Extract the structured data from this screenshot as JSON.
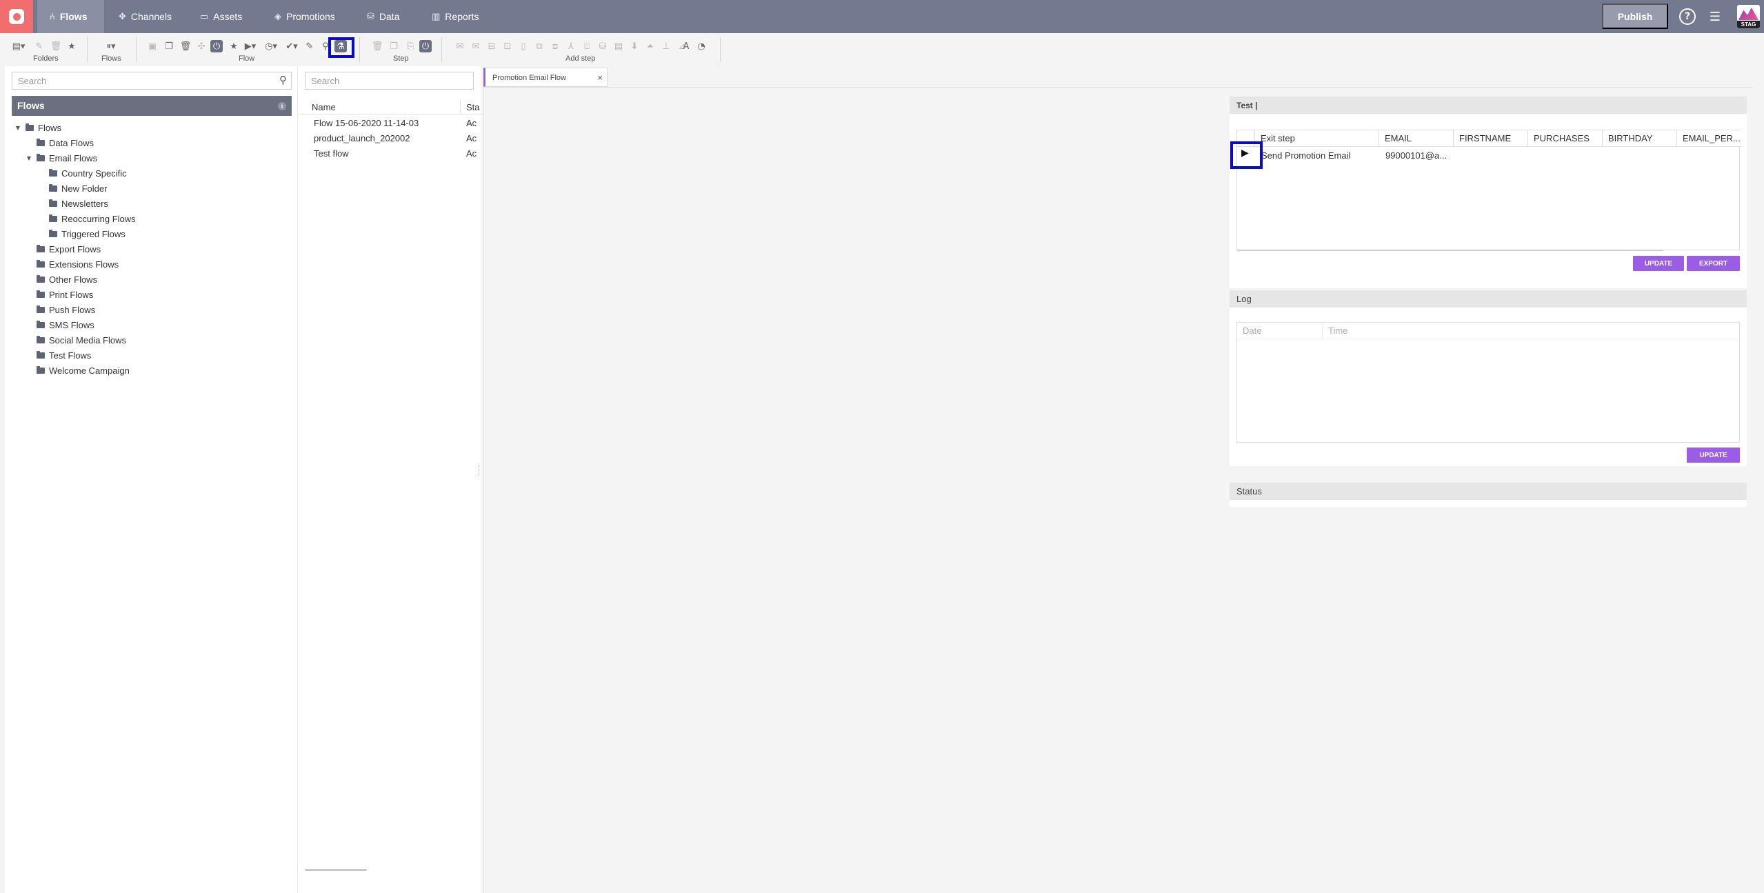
{
  "nav": {
    "items": [
      {
        "label": "Flows",
        "icon": "flows-icon"
      },
      {
        "label": "Channels",
        "icon": "channels-icon"
      },
      {
        "label": "Assets",
        "icon": "assets-icon"
      },
      {
        "label": "Promotions",
        "icon": "promotions-icon"
      },
      {
        "label": "Data",
        "icon": "data-icon"
      },
      {
        "label": "Reports",
        "icon": "reports-icon"
      }
    ],
    "publish_label": "Publish",
    "env_badge": "STAG"
  },
  "toolbar": {
    "groups": {
      "folders": "Folders",
      "flows": "Flows",
      "flow": "Flow",
      "step": "Step",
      "add_step": "Add step"
    }
  },
  "left": {
    "search_placeholder": "Search",
    "header": "Flows",
    "tree": {
      "root": "Flows",
      "data_flows": "Data Flows",
      "email_flows": "Email Flows",
      "country_specific": "Country Specific",
      "new_folder": "New Folder",
      "newsletters": "Newsletters",
      "reoccurring_flows": "Reoccurring Flows",
      "triggered_flows": "Triggered Flows",
      "export_flows": "Export Flows",
      "extensions_flows": "Extensions Flows",
      "other_flows": "Other Flows",
      "print_flows": "Print Flows",
      "push_flows": "Push Flows",
      "sms_flows": "SMS Flows",
      "social_media_flows": "Social Media Flows",
      "test_flows": "Test Flows",
      "welcome_campaign": "Welcome Campaign"
    }
  },
  "middle": {
    "search_placeholder": "Search",
    "columns": {
      "name": "Name",
      "status": "Sta"
    },
    "rows": [
      {
        "name": "Flow 15-06-2020 11-14-03",
        "status": "Ac"
      },
      {
        "name": "product_launch_202002",
        "status": "Ac"
      },
      {
        "name": "Test flow",
        "status": "Ac"
      }
    ]
  },
  "tab": {
    "label": "Promotion Email Flow",
    "close": "×"
  },
  "test_panel": {
    "title": "Test |",
    "columns": {
      "exit_step": "Exit step",
      "email": "EMAIL",
      "firstname": "FIRSTNAME",
      "purchases": "PURCHASES",
      "birthday": "BIRTHDAY",
      "email_per": "EMAIL_PER..."
    },
    "row": {
      "exit_step": "Send Promotion Email",
      "email": "99000101@a..."
    },
    "update_label": "UPDATE",
    "export_label": "EXPORT"
  },
  "log_panel": {
    "title": "Log",
    "columns": {
      "date": "Date",
      "time": "Time"
    },
    "update_label": "UPDATE"
  },
  "status_panel": {
    "title": "Status"
  },
  "colors": {
    "topbar": "#737a8f",
    "accent": "#9b5de5",
    "logo": "#f26d6d",
    "highlight": "#0a0ac8"
  }
}
